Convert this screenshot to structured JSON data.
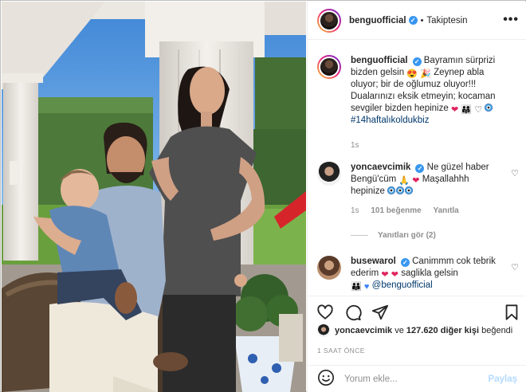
{
  "post": {
    "author": "benguofficial",
    "follow_status": "Takiptesin",
    "more_label": "•••",
    "icons": {
      "verified": "verified-badge-icon",
      "more": "more-options-icon"
    }
  },
  "comments": [
    {
      "username": "benguofficial",
      "verified": true,
      "text_1": "Bayramın sürprizi bizden gelsin",
      "text_2": "Zeynep abla oluyor; bir de oğlumuz oluyor!!! Dualarınızı eksik etmeyin; kocaman sevgiler bizden hepinize",
      "hashtag": "#14haftalıkoldukbiz",
      "time": "1s"
    },
    {
      "username": "yoncaevcimik",
      "verified": true,
      "text_1": "Ne güzel haber Bengü'cüm",
      "text_2": "Maşallahhh hepinize",
      "time": "1s",
      "likes": "101 beğenme",
      "reply": "Yanıtla"
    },
    {
      "username": "busewarol",
      "verified": true,
      "text_1": "Canimmm cok tebrik ederim",
      "text_2": "saglikla gelsin",
      "mention": "@benguofficial"
    }
  ],
  "view_replies": "Yanıtları gör (2)",
  "actions": {
    "like_icon": "heart-icon",
    "comment_icon": "comment-icon",
    "share_icon": "paper-plane-icon",
    "save_icon": "bookmark-icon"
  },
  "likes_line": {
    "first_user": "yoncaevcimik",
    "connector": "ve",
    "others": "127.620 diğer kişi",
    "suffix": "beğendi"
  },
  "timestamp": "1 SAAT ÖNCE",
  "comment_box": {
    "emoji_icon": "smiley-icon",
    "placeholder": "Yorum ekle...",
    "share_label": "Paylaş"
  },
  "colors": {
    "link": "#00376b",
    "muted": "#8e8e8e",
    "verified": "#3897f0",
    "share_disabled": "#b3dbff"
  }
}
